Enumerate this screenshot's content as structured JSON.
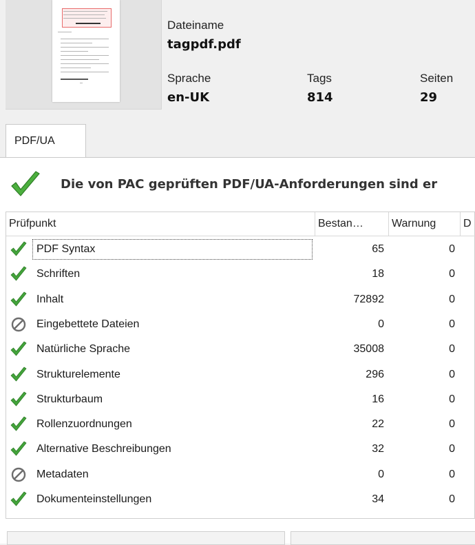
{
  "file": {
    "name_label": "Dateiname",
    "name_value": "tagpdf.pdf",
    "language_label": "Sprache",
    "language_value": "en-UK",
    "tags_label": "Tags",
    "tags_value": "814",
    "pages_label": "Seiten",
    "pages_value": "29"
  },
  "tabs": [
    {
      "label": "PDF/UA"
    }
  ],
  "status": {
    "message": "Die von PAC geprüften PDF/UA-Anforderungen sind er",
    "icon": "check-icon"
  },
  "table": {
    "columns": [
      "Prüfpunkt",
      "Bestan…",
      "Warnung",
      "D"
    ],
    "rows": [
      {
        "icon": "check-icon",
        "name": "PDF Syntax",
        "bestanden": "65",
        "warnung": "0"
      },
      {
        "icon": "check-icon",
        "name": "Schriften",
        "bestanden": "18",
        "warnung": "0"
      },
      {
        "icon": "check-icon",
        "name": "Inhalt",
        "bestanden": "72892",
        "warnung": "0"
      },
      {
        "icon": "not-applicable-icon",
        "name": "Eingebettete Dateien",
        "bestanden": "0",
        "warnung": "0"
      },
      {
        "icon": "check-icon",
        "name": "Natürliche Sprache",
        "bestanden": "35008",
        "warnung": "0"
      },
      {
        "icon": "check-icon",
        "name": "Strukturelemente",
        "bestanden": "296",
        "warnung": "0"
      },
      {
        "icon": "check-icon",
        "name": "Strukturbaum",
        "bestanden": "16",
        "warnung": "0"
      },
      {
        "icon": "check-icon",
        "name": "Rollenzuordnungen",
        "bestanden": "22",
        "warnung": "0"
      },
      {
        "icon": "check-icon",
        "name": "Alternative Beschreibungen",
        "bestanden": "32",
        "warnung": "0"
      },
      {
        "icon": "not-applicable-icon",
        "name": "Metadaten",
        "bestanden": "0",
        "warnung": "0"
      },
      {
        "icon": "check-icon",
        "name": "Dokumenteinstellungen",
        "bestanden": "34",
        "warnung": "0"
      }
    ]
  },
  "colors": {
    "check_green": "#43a33b",
    "na_gray": "#6d6d6d"
  }
}
